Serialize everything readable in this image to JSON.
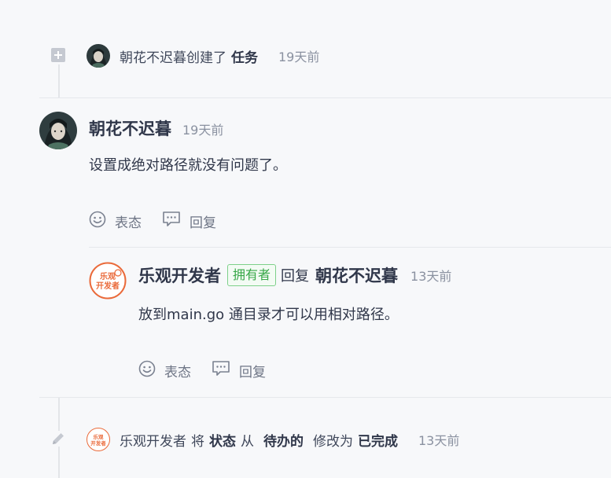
{
  "events": {
    "created": {
      "user": "朝花不迟暮",
      "action": "创建了",
      "target": "任务",
      "time": "19天前"
    },
    "status_change": {
      "user": "乐观开发者",
      "verb": "将",
      "field": "状态",
      "from_word": "从",
      "from_value": "待办的",
      "to_word": "修改为",
      "to_value": "已完成",
      "time": "13天前"
    }
  },
  "comment": {
    "author": "朝花不迟暮",
    "time": "19天前",
    "text": "设置成绝对路径就没有问题了。",
    "actions": {
      "react": "表态",
      "reply": "回复"
    }
  },
  "reply": {
    "author": "乐观开发者",
    "badge": "拥有者",
    "reply_word": "回复",
    "reply_to": "朝花不迟暮",
    "time": "13天前",
    "text": "放到main.go 通目录才可以用相对路径。",
    "actions": {
      "react": "表态",
      "reply": "回复"
    }
  },
  "logo": {
    "line1": "乐观",
    "line2": "开发者"
  },
  "colors": {
    "logo_orange": "#ea6a3a",
    "badge_green": "#38a849"
  },
  "icons": [
    "plus-square-icon",
    "smile-icon",
    "comment-icon",
    "pencil-icon"
  ]
}
